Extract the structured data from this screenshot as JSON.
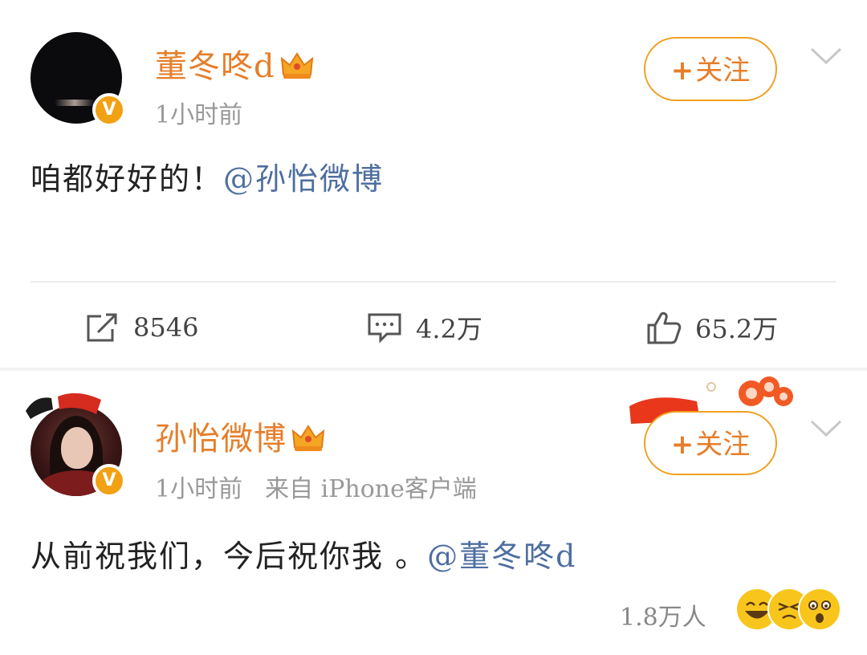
{
  "posts": [
    {
      "username": "董冬咚d",
      "time": "1小时前",
      "source": "",
      "follow_label": "关注",
      "follow_plus": "+",
      "content_text": "咱都好好的！",
      "content_mention": "@孙怡微博",
      "icons": {
        "avatar": "avatar-dark",
        "verified": "verified-v-icon",
        "crown": "crown-icon",
        "chevron": "chevron-down-icon"
      },
      "verified_mark": "V",
      "stats": {
        "reposts": "8546",
        "comments": "4.2万",
        "likes": "65.2万"
      }
    },
    {
      "username": "孙怡微博",
      "time": "1小时前",
      "source": "来自 iPhone客户端",
      "follow_label": "关注",
      "follow_plus": "+",
      "content_text": "从前祝我们，今后祝你我 。",
      "content_mention": "@董冬咚d",
      "icons": {
        "avatar": "avatar-portrait",
        "verified": "verified-v-icon",
        "crown": "crown-icon",
        "chevron": "chevron-down-icon"
      },
      "verified_mark": "V",
      "reaction_count": "1.8万人",
      "reaction_emojis": [
        "laughing-emoji",
        "squinting-emoji",
        "surprised-emoji"
      ]
    }
  ],
  "colors": {
    "username": "#e67e2a",
    "mention": "#4e6ea0",
    "follow_border": "#f0a020",
    "verified": "#f2a114",
    "meta": "#999999"
  }
}
